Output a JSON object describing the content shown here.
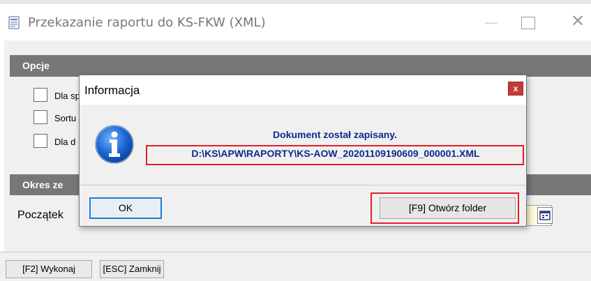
{
  "window": {
    "title": "Przekazanie raportu do KS-FKW (XML)",
    "minimize": "—",
    "close": "✕"
  },
  "sections": {
    "opcje": "Opcje",
    "okres": "Okres ze"
  },
  "options": [
    {
      "label": "Dla sp",
      "checked": false
    },
    {
      "label": "Sortu",
      "checked": false
    },
    {
      "label": "Dla d",
      "checked": false
    }
  ],
  "period": {
    "start_label": "Początek"
  },
  "footer": {
    "execute": "[F2] Wykonaj",
    "close": "[ESC] Zamknij"
  },
  "dialog": {
    "title": "Informacja",
    "close": "x",
    "message": "Dokument został zapisany.",
    "path": "D:\\KS\\APW\\RAPORTY\\KS-AOW_20201109190609_000001.XML",
    "ok": "OK",
    "open_folder": "[F9] Otwórz folder"
  },
  "colors": {
    "section_bar": "#777777",
    "message_text": "#0a2b8c",
    "highlight": "#e0202a",
    "ok_border": "#1e7fd6",
    "dialog_close": "#c43b3b"
  }
}
